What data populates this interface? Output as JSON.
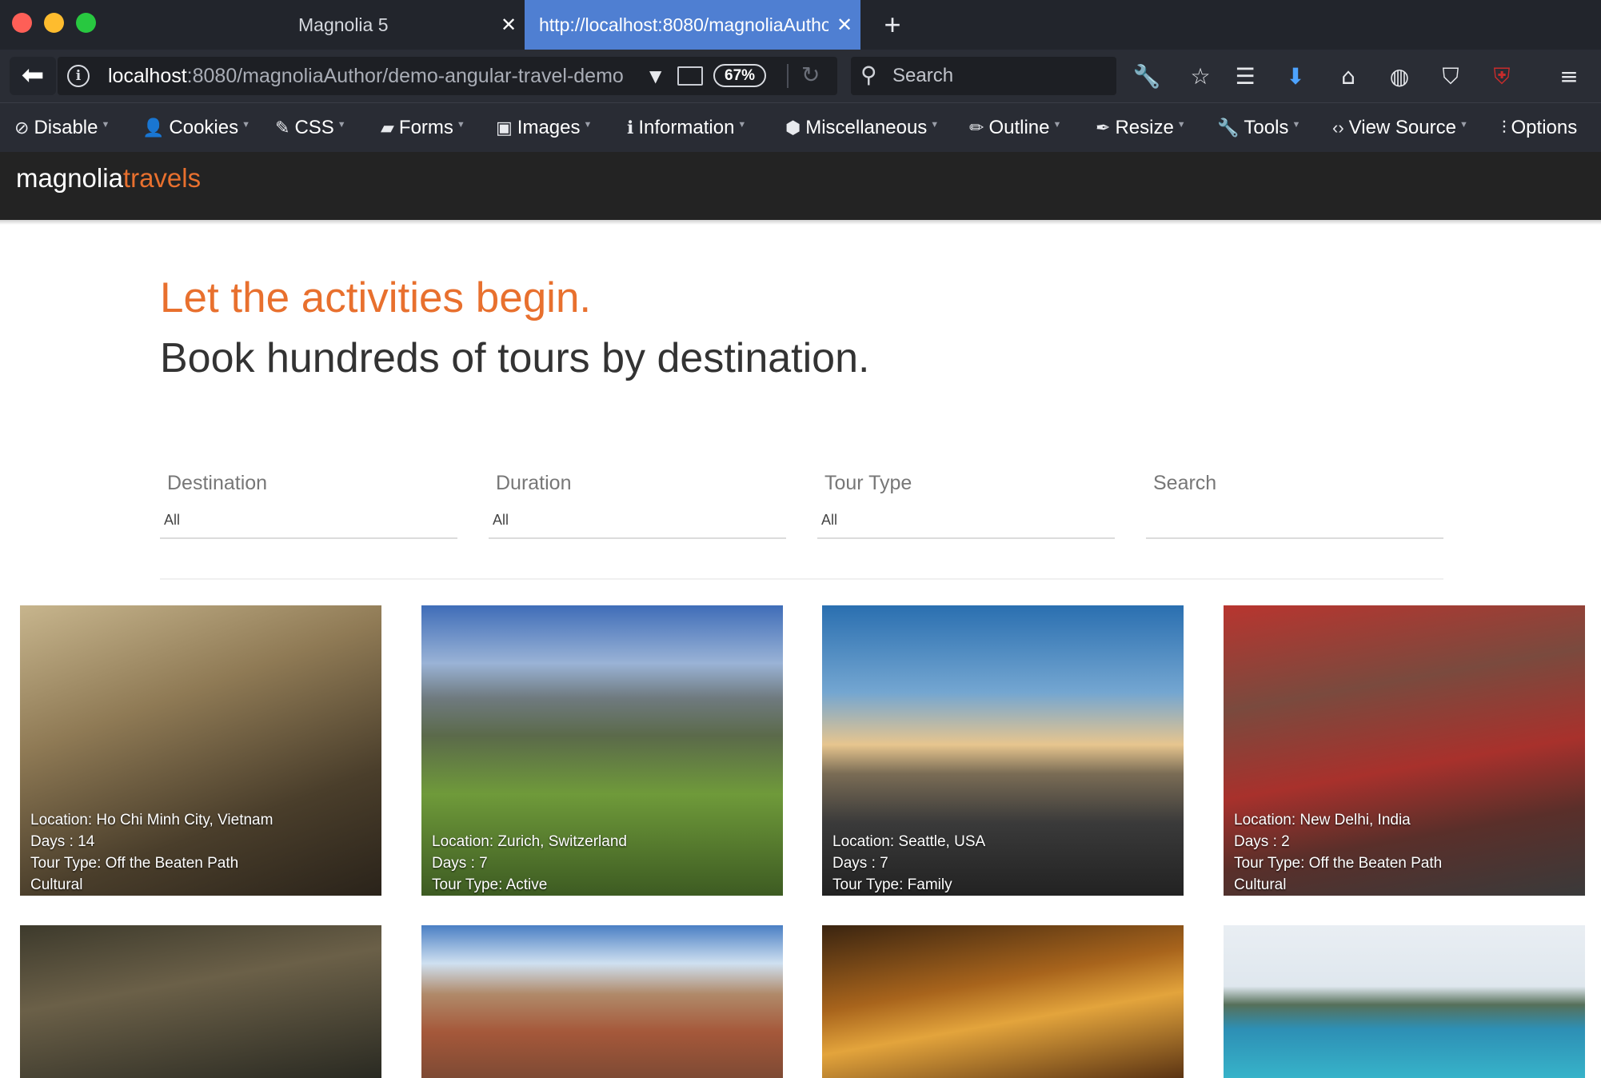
{
  "browser": {
    "tabs": [
      {
        "title": "Magnolia 5",
        "close": "✕"
      },
      {
        "title": "http://localhost:8080/magnoliaAuthor/demo-angular-travel-demo",
        "close": "✕"
      }
    ],
    "new_tab": "+",
    "url_host": "localhost",
    "url_rest": ":8080/magnoliaAuthor/demo-angular-travel-demo",
    "zoom": "67%",
    "search_placeholder": "Search"
  },
  "devbar": {
    "items": [
      {
        "label": "Disable"
      },
      {
        "label": "Cookies"
      },
      {
        "label": "CSS"
      },
      {
        "label": "Forms"
      },
      {
        "label": "Images"
      },
      {
        "label": "Information"
      },
      {
        "label": "Miscellaneous"
      },
      {
        "label": "Outline"
      },
      {
        "label": "Resize"
      },
      {
        "label": "Tools"
      },
      {
        "label": "View Source"
      },
      {
        "label": "Options"
      }
    ]
  },
  "site": {
    "logo_part1": "magnolia",
    "logo_part2": "travels",
    "headline": "Let the activities begin.",
    "subheadline": "Book hundreds of tours by destination."
  },
  "filters": [
    {
      "label": "Destination",
      "value": "All"
    },
    {
      "label": "Duration",
      "value": "All"
    },
    {
      "label": "Tour Type",
      "value": "All"
    },
    {
      "label": "Search",
      "value": ""
    }
  ],
  "tours": [
    {
      "location": "Location: Ho Chi Minh City, Vietnam",
      "days": "Days : 14",
      "type": "Tour Type: Off the Beaten Path",
      "extra": "Cultural"
    },
    {
      "location": "Location: Zurich, Switzerland",
      "days": "Days : 7",
      "type": "Tour Type: Active",
      "extra": ""
    },
    {
      "location": "Location: Seattle, USA",
      "days": "Days : 7",
      "type": "Tour Type: Family",
      "extra": ""
    },
    {
      "location": "Location: New Delhi, India",
      "days": "Days : 2",
      "type": "Tour Type: Off the Beaten Path",
      "extra": "Cultural"
    }
  ]
}
